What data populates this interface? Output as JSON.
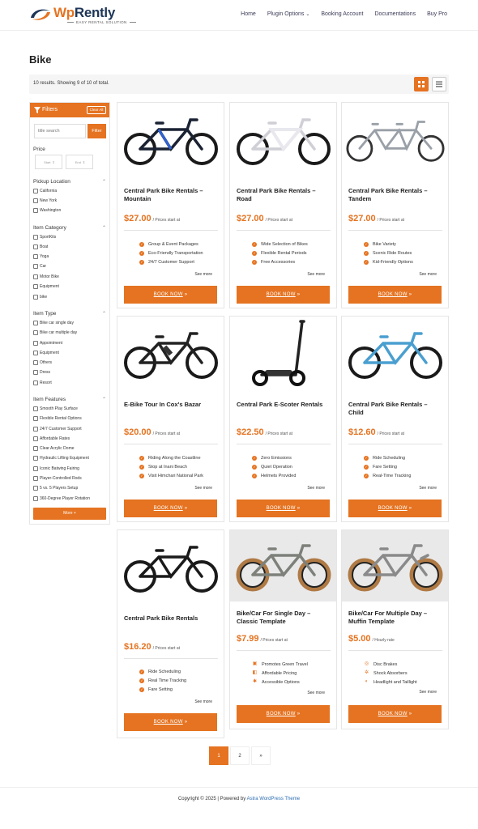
{
  "header": {
    "brand_wp": "Wp",
    "brand_rest": "Rently",
    "tagline": "EASY RENTAL SOLUTION",
    "nav": [
      "Home",
      "Plugin Options",
      "Booking Account",
      "Documentations",
      "Buy Pro"
    ]
  },
  "page": {
    "title": "Bike",
    "results": "10 results. Showing 9 of 10 of total."
  },
  "sidebar": {
    "title": "Filters",
    "clear_label": "Clear All",
    "search_placeholder": "title search",
    "search_button": "Filter",
    "price_label": "Price",
    "price_start": "Start",
    "price_end": "End",
    "pickup_label": "Pickup Location",
    "pickup_options": [
      "California",
      "New York",
      "Washington"
    ],
    "category_label": "Item Category",
    "category_options": [
      "SportKits",
      "Boat",
      "Yoga",
      "Car",
      "Motor Bike",
      "Equipment",
      "bike"
    ],
    "type_label": "Item Type",
    "type_options": [
      "Bike car single day",
      "Bike car multiple day",
      "Appointment",
      "Equipment",
      "Others",
      "Dress",
      "Resort"
    ],
    "features_label": "Item Features",
    "features_options": [
      "Smooth Play Surface",
      "Flexible Rental Options",
      "24/7 Customer Support",
      "Affordable Rates",
      "Clear Acrylic Dome",
      "Hydraulic Lifting Equipment",
      "Iconic Batwing Fairing",
      "Player-Controlled Rods",
      "5 vs. 5 Players Setup",
      "360-Degree Player Rotation"
    ],
    "more_label": "More +"
  },
  "cards": [
    {
      "title": "Central Park Bike Rentals – Mountain",
      "price": "$27.00",
      "price_note": "/ Prices start at",
      "features": [
        "Group & Event Packages",
        "Eco-Friendly Transportation",
        "24/7 Customer Support"
      ],
      "see_more": "See more",
      "book": "BOOK NOW"
    },
    {
      "title": "Central Park Bike Rentals – Road",
      "price": "$27.00",
      "price_note": "/ Prices start at",
      "features": [
        "Wide Selection of Bikes",
        "Flexible Rental Periods",
        "Free Accessories"
      ],
      "see_more": "See more",
      "book": "BOOK NOW"
    },
    {
      "title": "Central Park Bike Rentals – Tandem",
      "price": "$27.00",
      "price_note": "/ Prices start at",
      "features": [
        "Bike Variety",
        "Scenic Ride Routes",
        "Kid-Friendly Options"
      ],
      "see_more": "See more",
      "book": "BOOK NOW"
    },
    {
      "title": "E-Bike Tour In Cox's Bazar",
      "price": "$20.00",
      "price_note": "/ Prices start at",
      "features": [
        "Riding Along the Coastline",
        "Stop at Inani Beach",
        "Visit Himchari National Park"
      ],
      "see_more": "See more",
      "book": "BOOK NOW"
    },
    {
      "title": "Central Park E-Scoter Rentals",
      "price": "$22.50",
      "price_note": "/ Prices start at",
      "features": [
        "Zero Emissions",
        "Quiet Operation",
        "Helmets Provided"
      ],
      "see_more": "See more",
      "book": "BOOK NOW"
    },
    {
      "title": "Central Park Bike Rentals – Child",
      "price": "$12.60",
      "price_note": "/ Prices start at",
      "features": [
        "Ride Scheduling",
        "Fare Setting",
        "Real-Time Tracking"
      ],
      "see_more": "See more",
      "book": "BOOK NOW"
    },
    {
      "title": "Central Park Bike Rentals",
      "price": "$16.20",
      "price_note": "/ Prices start at",
      "features": [
        "Ride Scheduling",
        "Real Time Tracking",
        "Fare Setting"
      ],
      "see_more": "See more",
      "book": "BOOK NOW"
    },
    {
      "title": "Bike/Car For Single Day – Classic Template",
      "price": "$7.99",
      "price_note": "/ Prices start at",
      "features": [
        "Promotes Green Travel",
        "Affordable Pricing",
        "Accessible Options"
      ],
      "see_more": "See more",
      "book": "BOOK NOW"
    },
    {
      "title": "Bike/Car For Multiple Day – Muffin Template",
      "price": "$5.00",
      "price_note": "/ Hourly rate",
      "features": [
        "Disc Brakes",
        "Shock Absorbers",
        "Headlight and Taillight"
      ],
      "see_more": "See more",
      "book": "BOOK NOW"
    }
  ],
  "pagination": [
    "1",
    "2",
    "»"
  ],
  "footer": {
    "prefix": "Copyright © 2025 | Powered by",
    "link": "Astra WordPress Theme"
  },
  "colors": {
    "accent": "#e57321",
    "brand_blue": "#1d3557"
  }
}
